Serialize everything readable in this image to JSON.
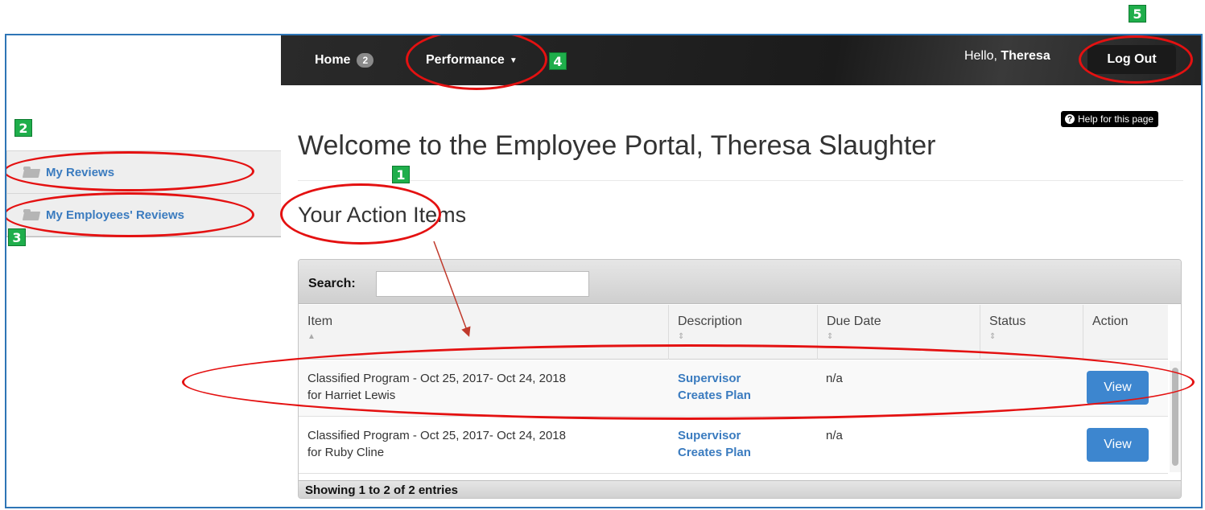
{
  "nav": {
    "home_label": "Home",
    "home_badge": "2",
    "performance_label": "Performance",
    "hello_prefix": "Hello,",
    "user_first_name": "Theresa",
    "logout_label": "Log Out"
  },
  "sidebar": {
    "items": [
      {
        "label": "My Reviews",
        "icon": "folder-icon"
      },
      {
        "label": "My Employees' Reviews",
        "icon": "folder-icon"
      }
    ]
  },
  "help_label": "Help for this page",
  "page_title": "Welcome to the Employee Portal, Theresa Slaughter",
  "section_title": "Your Action Items",
  "table": {
    "search_label": "Search:",
    "search_value": "",
    "columns": [
      "Item",
      "Description",
      "Due Date",
      "Status",
      "Action"
    ],
    "rows": [
      {
        "item_line1": "Classified Program - Oct 25, 2017- Oct 24, 2018",
        "item_line2": "for Harriet Lewis",
        "desc_line1": "Supervisor",
        "desc_line2": "Creates Plan",
        "due": "n/a",
        "status": "",
        "action": "View"
      },
      {
        "item_line1": "Classified Program - Oct 25, 2017- Oct 24, 2018",
        "item_line2": "for Ruby Cline",
        "desc_line1": "Supervisor",
        "desc_line2": "Creates Plan",
        "due": "n/a",
        "status": "",
        "action": "View"
      }
    ],
    "footer": "Showing 1 to 2 of 2 entries"
  },
  "callouts": [
    "1",
    "2",
    "3",
    "4",
    "5"
  ],
  "colors": {
    "accent": "#3d86cf",
    "callout_green": "#1fae4b",
    "callout_red": "#e41111",
    "navbar": "#1b1b1b"
  }
}
